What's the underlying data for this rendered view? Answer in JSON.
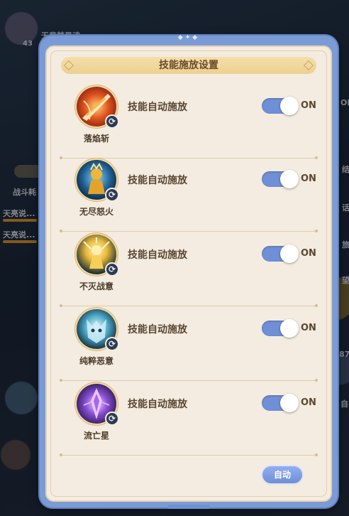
{
  "background": {
    "player_name": "无意梦星魂",
    "level": "43",
    "battle_label": "战斗耗",
    "chat_lines": [
      "天亮说...",
      "天亮说..."
    ],
    "side_labels": [
      "ON",
      "结",
      "话",
      "旅",
      "望",
      "87",
      "自"
    ]
  },
  "dialog": {
    "title": "技能施放设置",
    "skills": [
      {
        "name": "落焰斩",
        "auto_label": "技能自动施放",
        "toggle_state": "ON",
        "icon": "flame-slash-icon",
        "enabled": true
      },
      {
        "name": "无尽怒火",
        "auto_label": "技能自动施放",
        "toggle_state": "ON",
        "icon": "golden-warrior-icon",
        "enabled": true
      },
      {
        "name": "不灭战意",
        "auto_label": "技能自动施放",
        "toggle_state": "ON",
        "icon": "radiant-figure-icon",
        "enabled": true
      },
      {
        "name": "纯粹恶意",
        "auto_label": "技能自动施放",
        "toggle_state": "ON",
        "icon": "spectral-beast-icon",
        "enabled": true
      },
      {
        "name": "流亡星",
        "auto_label": "技能自动施放",
        "toggle_state": "ON",
        "icon": "purple-crystal-icon",
        "enabled": true
      }
    ],
    "auto_button_label": "自动"
  },
  "colors": {
    "panel_border": "#7b9bd6",
    "panel_bg": "#f4ece0",
    "title_bar": "#f5dfa9",
    "toggle_on": "#6f8fd6",
    "text_primary": "#5a4631"
  }
}
